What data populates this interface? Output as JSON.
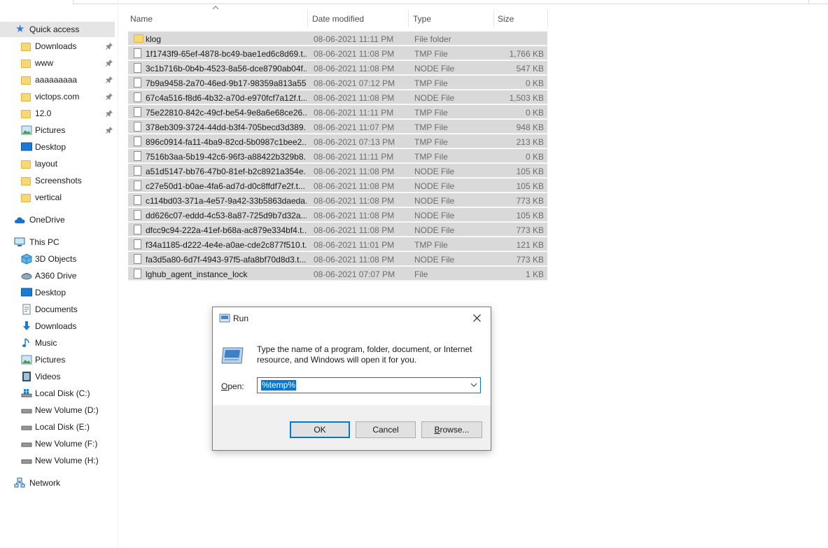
{
  "sidebar": {
    "quick_access": "Quick access",
    "pinned": [
      {
        "label": "Downloads",
        "icon": "folder-icon"
      },
      {
        "label": "www",
        "icon": "folder-icon"
      },
      {
        "label": "aaaaaaaaa",
        "icon": "folder-icon"
      },
      {
        "label": "victops.com",
        "icon": "folder-icon"
      },
      {
        "label": "12.0",
        "icon": "folder-icon"
      },
      {
        "label": "Pictures",
        "icon": "pictures-icon"
      }
    ],
    "recent": [
      {
        "label": "Desktop",
        "icon": "desktop-icon"
      },
      {
        "label": "layout",
        "icon": "folder-icon"
      },
      {
        "label": "Screenshots",
        "icon": "folder-icon"
      },
      {
        "label": "vertical",
        "icon": "folder-icon"
      }
    ],
    "onedrive": "OneDrive",
    "this_pc": "This PC",
    "pc_items": [
      {
        "label": "3D Objects",
        "icon": "3d-objects-icon"
      },
      {
        "label": "A360 Drive",
        "icon": "a360-drive-icon"
      },
      {
        "label": "Desktop",
        "icon": "desktop-icon"
      },
      {
        "label": "Documents",
        "icon": "documents-icon"
      },
      {
        "label": "Downloads",
        "icon": "downloads-icon"
      },
      {
        "label": "Music",
        "icon": "music-icon"
      },
      {
        "label": "Pictures",
        "icon": "pictures-icon"
      },
      {
        "label": "Videos",
        "icon": "videos-icon"
      },
      {
        "label": "Local Disk (C:)",
        "icon": "drive-icon"
      },
      {
        "label": "New Volume (D:)",
        "icon": "drive-icon"
      },
      {
        "label": "Local Disk (E:)",
        "icon": "drive-icon"
      },
      {
        "label": "New Volume (F:)",
        "icon": "drive-icon"
      },
      {
        "label": "New Volume (H:)",
        "icon": "drive-icon"
      }
    ],
    "network": "Network"
  },
  "columns": {
    "name": "Name",
    "date": "Date modified",
    "type": "Type",
    "size": "Size"
  },
  "files": [
    {
      "name": "klog",
      "date": "08-06-2021 11:11 PM",
      "type": "File folder",
      "size": "",
      "kind": "folder"
    },
    {
      "name": "1f1743f9-65ef-4878-bc49-bae1ed6c8d69.t...",
      "date": "08-06-2021 11:08 PM",
      "type": "TMP File",
      "size": "1,766 KB",
      "kind": "file"
    },
    {
      "name": "3c1b716b-0b4b-4523-8a56-dce8790ab04f...",
      "date": "08-06-2021 11:08 PM",
      "type": "NODE File",
      "size": "547 KB",
      "kind": "file"
    },
    {
      "name": "7b9a9458-2a70-46ed-9b17-98359a813a55...",
      "date": "08-06-2021 07:12 PM",
      "type": "TMP File",
      "size": "0 KB",
      "kind": "file"
    },
    {
      "name": "67c4a516-f8d6-4b32-a70d-e970fcf7a12f.t...",
      "date": "08-06-2021 11:08 PM",
      "type": "NODE File",
      "size": "1,503 KB",
      "kind": "file"
    },
    {
      "name": "75e22810-842c-49cf-be54-9e8a6e68ce26....",
      "date": "08-06-2021 11:11 PM",
      "type": "TMP File",
      "size": "0 KB",
      "kind": "file"
    },
    {
      "name": "378eb309-3724-44dd-b3f4-705becd3d389...",
      "date": "08-06-2021 11:07 PM",
      "type": "TMP File",
      "size": "948 KB",
      "kind": "file"
    },
    {
      "name": "896c0914-fa11-4ba9-82cd-5b0987c1bee2....",
      "date": "08-06-2021 07:13 PM",
      "type": "TMP File",
      "size": "213 KB",
      "kind": "file"
    },
    {
      "name": "7516b3aa-5b19-42c6-96f3-a88422b329b8....",
      "date": "08-06-2021 11:11 PM",
      "type": "TMP File",
      "size": "0 KB",
      "kind": "file"
    },
    {
      "name": "a51d5147-bb76-47b0-81ef-b2c8921a354e...",
      "date": "08-06-2021 11:08 PM",
      "type": "NODE File",
      "size": "105 KB",
      "kind": "file"
    },
    {
      "name": "c27e50d1-b0ae-4fa6-ad7d-d0c8ffdf7e2f.t...",
      "date": "08-06-2021 11:08 PM",
      "type": "NODE File",
      "size": "105 KB",
      "kind": "file"
    },
    {
      "name": "c114bd03-371a-4e57-9a42-33b5863daeda...",
      "date": "08-06-2021 11:08 PM",
      "type": "NODE File",
      "size": "773 KB",
      "kind": "file"
    },
    {
      "name": "dd626c07-eddd-4c53-8a87-725d9b7d32a...",
      "date": "08-06-2021 11:08 PM",
      "type": "NODE File",
      "size": "105 KB",
      "kind": "file"
    },
    {
      "name": "dfcc9c94-222a-41ef-b68a-ac879e334bf4.t...",
      "date": "08-06-2021 11:08 PM",
      "type": "NODE File",
      "size": "773 KB",
      "kind": "file"
    },
    {
      "name": "f34a1185-d222-4e4e-a0ae-cde2c877f510.t...",
      "date": "08-06-2021 11:01 PM",
      "type": "TMP File",
      "size": "121 KB",
      "kind": "file"
    },
    {
      "name": "fa3d5a80-6d7f-4943-97f5-afa8bf70d8d3.t...",
      "date": "08-06-2021 11:08 PM",
      "type": "NODE File",
      "size": "773 KB",
      "kind": "file"
    },
    {
      "name": "lghub_agent_instance_lock",
      "date": "08-06-2021 07:07 PM",
      "type": "File",
      "size": "1 KB",
      "kind": "file"
    }
  ],
  "run_dialog": {
    "title": "Run",
    "message": "Type the name of a program, folder, document, or Internet resource, and Windows will open it for you.",
    "open_label": "Open:",
    "open_value": "%temp%",
    "ok": "OK",
    "cancel": "Cancel",
    "browse": "Browse...",
    "accent": "#0078d7"
  }
}
